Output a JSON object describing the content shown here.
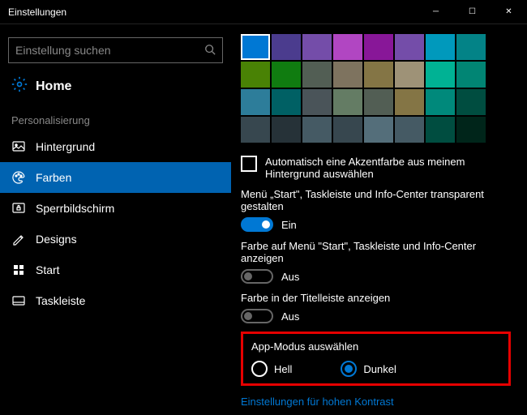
{
  "window": {
    "title": "Einstellungen"
  },
  "search": {
    "placeholder": "Einstellung suchen"
  },
  "home": {
    "label": "Home"
  },
  "section": {
    "label": "Personalisierung"
  },
  "nav": [
    {
      "id": "hintergrund",
      "label": "Hintergrund",
      "active": false
    },
    {
      "id": "farben",
      "label": "Farben",
      "active": true
    },
    {
      "id": "sperrbildschirm",
      "label": "Sperrbildschirm",
      "active": false
    },
    {
      "id": "designs",
      "label": "Designs",
      "active": false
    },
    {
      "id": "start",
      "label": "Start",
      "active": false
    },
    {
      "id": "taskleiste",
      "label": "Taskleiste",
      "active": false
    }
  ],
  "palette": [
    [
      "#0078d4",
      "#4b3c8e",
      "#744da9",
      "#b146c2",
      "#881798",
      "#744da9",
      "#0099bc",
      "#038387"
    ],
    [
      "#498205",
      "#107c10",
      "#525e54",
      "#7e735f",
      "#847545",
      "#9e9277",
      "#00b294",
      "#018574"
    ],
    [
      "#2d7d9a",
      "#006064",
      "#4a5459",
      "#647c64",
      "#525e54",
      "#847545",
      "#00897b",
      "#004d40"
    ],
    [
      "#37474f",
      "#263238",
      "#455a64",
      "#37474f",
      "#546e7a",
      "#455a64",
      "#004d40",
      "#00251a"
    ]
  ],
  "palette_selected": [
    0,
    0
  ],
  "accent_checkbox": {
    "label": "Automatisch eine Akzentfarbe aus meinem Hintergrund auswählen",
    "checked": false
  },
  "transparent": {
    "title": "Menü „Start\", Taskleiste und Info-Center transparent gestalten",
    "on": true,
    "state": "Ein"
  },
  "showcolor": {
    "title": "Farbe auf Menü \"Start\", Taskleiste und Info-Center anzeigen",
    "on": false,
    "state": "Aus"
  },
  "titlebarcolor": {
    "title": "Farbe in der Titelleiste anzeigen",
    "on": false,
    "state": "Aus"
  },
  "appmode": {
    "title": "App-Modus auswählen",
    "light": "Hell",
    "dark": "Dunkel",
    "selected": "dark"
  },
  "contrast_link": "Einstellungen für hohen Kontrast"
}
